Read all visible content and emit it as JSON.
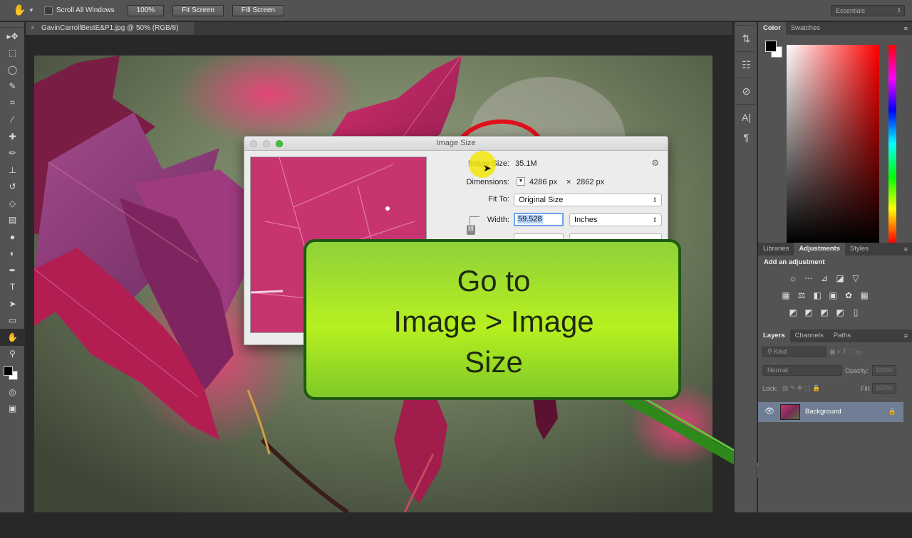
{
  "options_bar": {
    "scroll_all_windows": "Scroll All Windows",
    "zoom_button": "100%",
    "fit_screen": "Fit Screen",
    "fill_screen": "Fill Screen",
    "workspace": "Essentials"
  },
  "document": {
    "tab_title": "GavinCarrollBestE&P1.jpg @ 50% (RGB/8)"
  },
  "dialog": {
    "title": "Image Size",
    "image_size_label": "Image Size:",
    "image_size_value": "35.1M",
    "dimensions_label": "Dimensions:",
    "dimensions_width": "4286 px",
    "dimensions_x": "×",
    "dimensions_height": "2862 px",
    "fit_to_label": "Fit To:",
    "fit_to_value": "Original Size",
    "width_label": "Width:",
    "width_value": "59.528",
    "width_unit": "Inches"
  },
  "callout": {
    "line1": "Go to",
    "line2": "Image > Image",
    "line3": "Size",
    "color": "#8fd13a"
  },
  "color_panel": {
    "tabs": [
      "Color",
      "Swatches"
    ]
  },
  "adjustments_panel": {
    "tabs": [
      "Libraries",
      "Adjustments",
      "Styles"
    ],
    "heading": "Add an adjustment"
  },
  "layers_panel": {
    "tabs": [
      "Layers",
      "Channels",
      "Paths"
    ],
    "kind_filter": "Kind",
    "blend_mode": "Normal",
    "opacity_label": "Opacity:",
    "opacity_value": "100%",
    "lock_label": "Lock:",
    "fill_label": "Fill:",
    "fill_value": "100%",
    "layers": [
      {
        "name": "Background"
      }
    ]
  },
  "colors": {
    "annotation_red": "#e0101a",
    "highlight_yellow": "#f2e60a",
    "leaf_magenta": "#c8236a"
  }
}
